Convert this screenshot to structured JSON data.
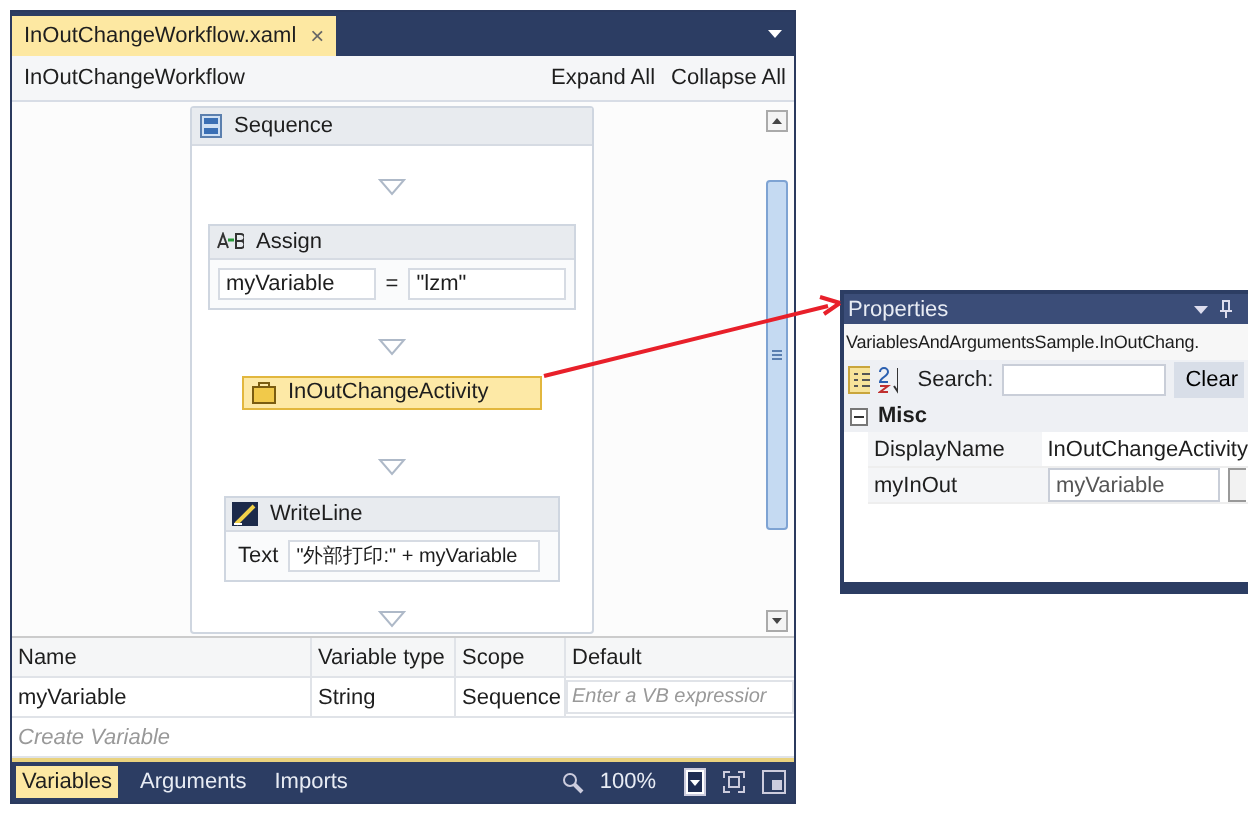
{
  "designer": {
    "tab": {
      "label": "InOutChangeWorkflow.xaml",
      "close": "×"
    },
    "breadcrumb": "InOutChangeWorkflow",
    "expand_all": "Expand All",
    "collapse_all": "Collapse All",
    "sequence": {
      "title": "Sequence",
      "activities": [
        {
          "kind": "assign",
          "title": "Assign",
          "to": "myVariable",
          "op": "=",
          "value": "\"lzm\"",
          "selected": false
        },
        {
          "kind": "activity",
          "title": "InOutChangeActivity",
          "selected": true
        },
        {
          "kind": "writeline",
          "title": "WriteLine",
          "label": "Text",
          "value": "\"外部打印:\" + myVariable",
          "selected": false
        }
      ]
    },
    "variables": {
      "columns": [
        "Name",
        "Variable type",
        "Scope",
        "Default"
      ],
      "rows": [
        {
          "cells": [
            "myVariable",
            "String",
            "Sequence"
          ],
          "default_placeholder": "Enter a VB expressior"
        }
      ],
      "create": "Create Variable"
    },
    "bottom_tabs": [
      {
        "label": "Variables",
        "selected": true
      },
      {
        "label": "Arguments",
        "selected": false
      },
      {
        "label": "Imports",
        "selected": false
      }
    ],
    "zoom": "100%"
  },
  "properties": {
    "title": "Properties",
    "object": "VariablesAndArgumentsSample.InOutChang.",
    "search_label": "Search:",
    "clear": "Clear",
    "category": "Misc",
    "expanded": true,
    "rows": [
      {
        "name": "DisplayName",
        "value": "InOutChangeActivity",
        "kind": "text"
      },
      {
        "name": "myInOut",
        "value": "myVariable",
        "kind": "field"
      }
    ]
  }
}
